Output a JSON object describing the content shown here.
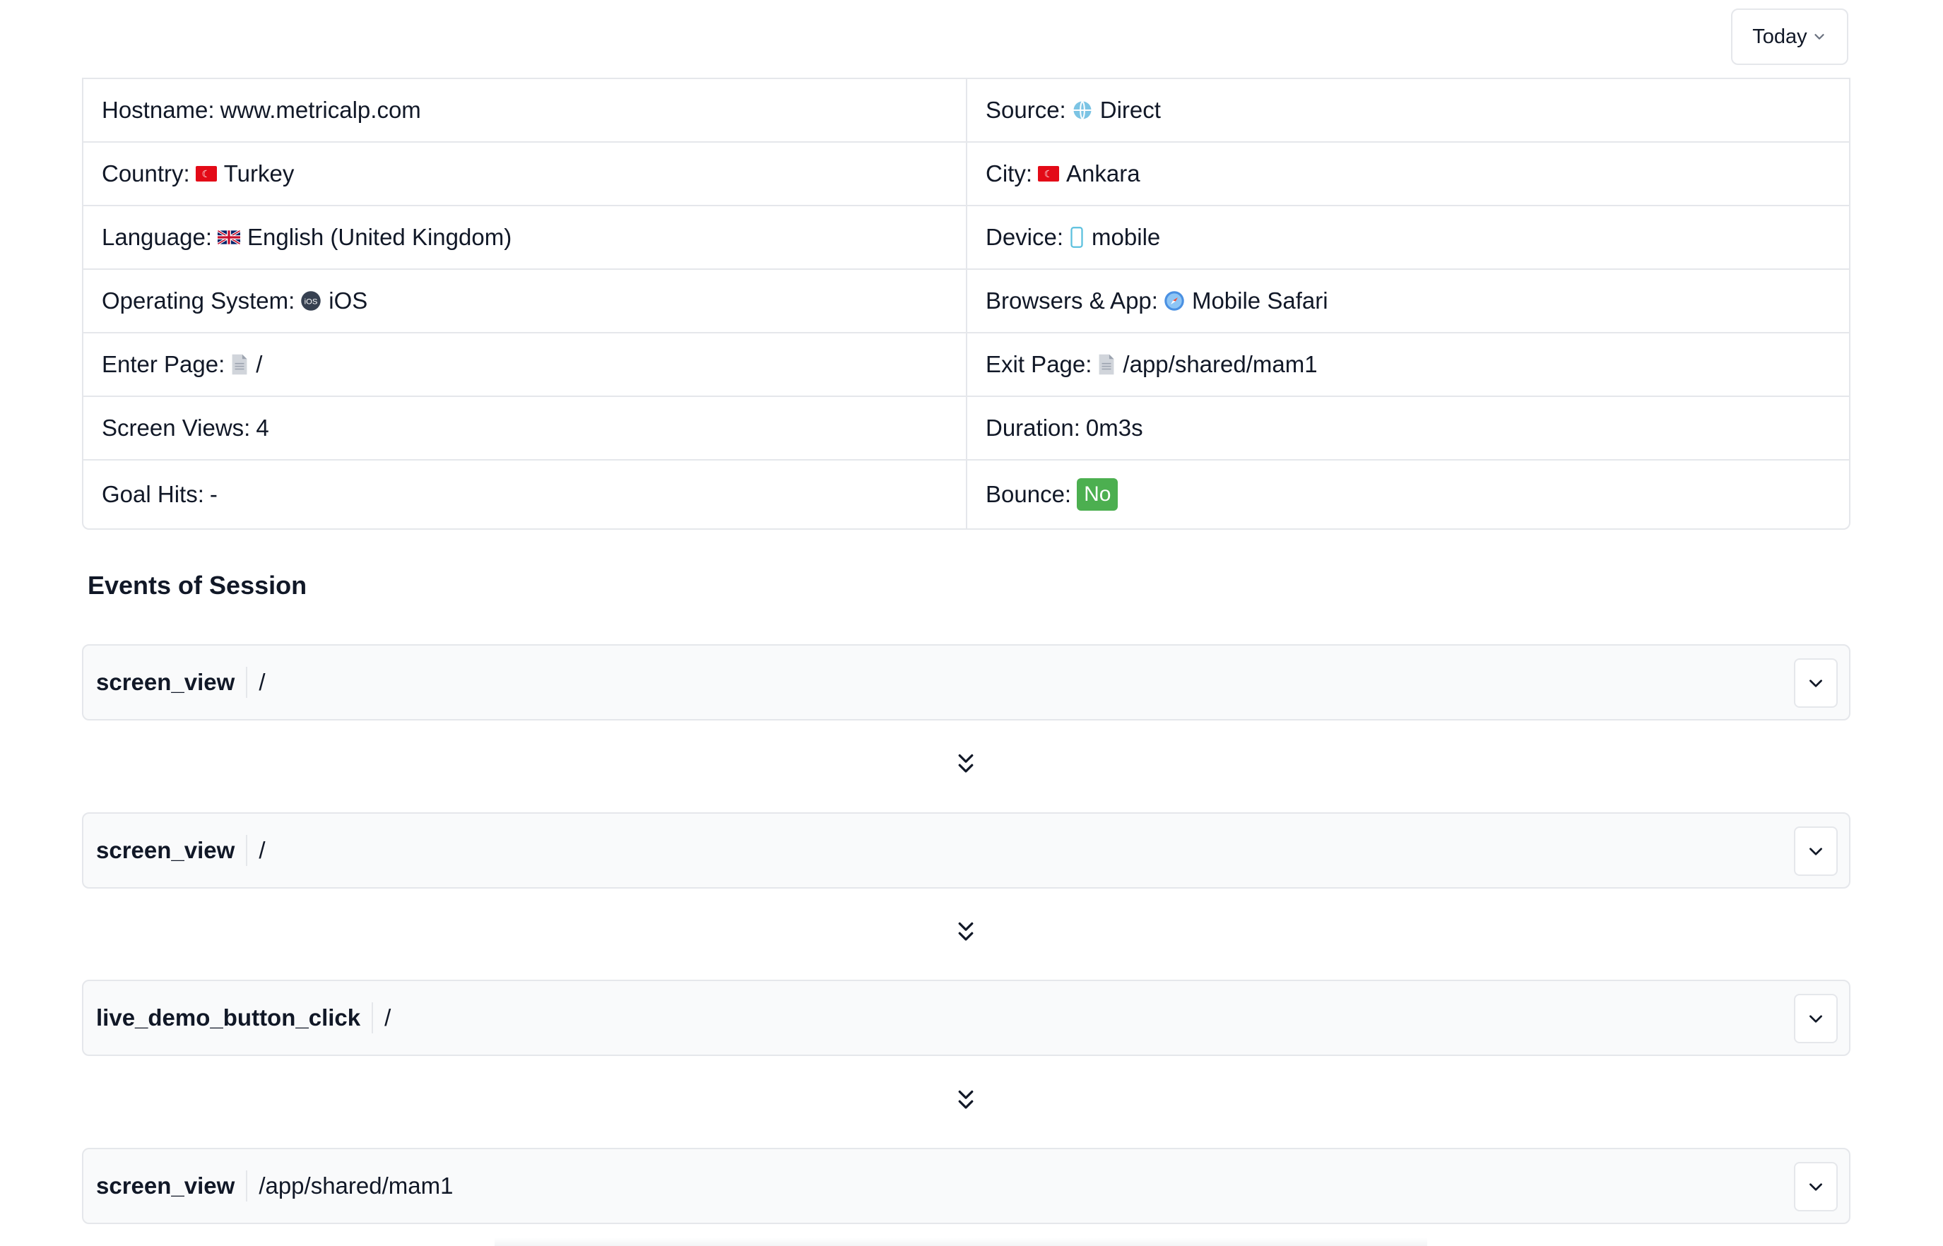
{
  "date_filter": {
    "label": "Today"
  },
  "session_info": {
    "rows": [
      [
        {
          "label": "Hostname:",
          "icon": "",
          "value": "www.metricalp.com"
        },
        {
          "label": "Source:",
          "icon": "globe-icon",
          "value": "Direct"
        }
      ],
      [
        {
          "label": "Country:",
          "icon": "turkey-flag-icon",
          "value": "Turkey"
        },
        {
          "label": "City:",
          "icon": "turkey-flag-icon",
          "value": "Ankara"
        }
      ],
      [
        {
          "label": "Language:",
          "icon": "uk-flag-icon",
          "value": "English (United Kingdom)"
        },
        {
          "label": "Device:",
          "icon": "mobile-device-icon",
          "value": "mobile"
        }
      ],
      [
        {
          "label": "Operating System:",
          "icon": "ios-icon",
          "value": "iOS"
        },
        {
          "label": "Browsers & App:",
          "icon": "safari-icon",
          "value": "Mobile Safari"
        }
      ],
      [
        {
          "label": "Enter Page:",
          "icon": "page-icon",
          "value": "/"
        },
        {
          "label": "Exit Page:",
          "icon": "page-icon",
          "value": "/app/shared/mam1"
        }
      ],
      [
        {
          "label": "Screen Views:",
          "icon": "",
          "value": "4"
        },
        {
          "label": "Duration:",
          "icon": "",
          "value": "0m3s"
        }
      ],
      [
        {
          "label": "Goal Hits:",
          "icon": "",
          "value": "-"
        },
        {
          "label": "Bounce:",
          "icon": "",
          "value": "No",
          "badge_color": "#4caf50"
        }
      ]
    ]
  },
  "events_section": {
    "title": "Events of Session",
    "events": [
      {
        "name": "screen_view",
        "path": "/"
      },
      {
        "name": "screen_view",
        "path": "/"
      },
      {
        "name": "live_demo_button_click",
        "path": "/"
      },
      {
        "name": "screen_view",
        "path": "/app/shared/mam1"
      }
    ]
  },
  "colors": {
    "border": "#e5e7eb",
    "card_bg": "#f9fafb",
    "badge_green": "#4caf50",
    "flag_red": "#e30a17"
  }
}
